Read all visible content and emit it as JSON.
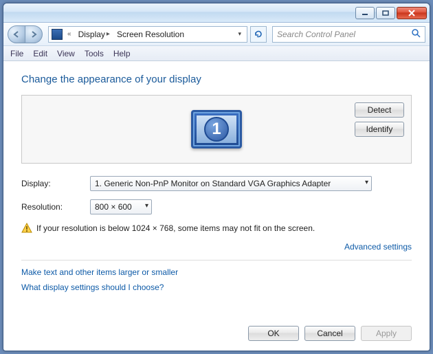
{
  "breadcrumb": {
    "item1": "Display",
    "item2": "Screen Resolution"
  },
  "search": {
    "placeholder": "Search Control Panel"
  },
  "menu": {
    "file": "File",
    "edit": "Edit",
    "view": "View",
    "tools": "Tools",
    "help": "Help"
  },
  "page": {
    "title": "Change the appearance of your display"
  },
  "preview": {
    "monitor_number": "1",
    "detect": "Detect",
    "identify": "Identify"
  },
  "form": {
    "display_label": "Display:",
    "display_value": "1. Generic Non-PnP Monitor on Standard VGA Graphics Adapter",
    "resolution_label": "Resolution:",
    "resolution_value": "800 × 600"
  },
  "warning": "If your resolution is below 1024 × 768, some items may not fit on the screen.",
  "links": {
    "advanced": "Advanced settings",
    "larger": "Make text and other items larger or smaller",
    "which": "What display settings should I choose?"
  },
  "buttons": {
    "ok": "OK",
    "cancel": "Cancel",
    "apply": "Apply"
  }
}
